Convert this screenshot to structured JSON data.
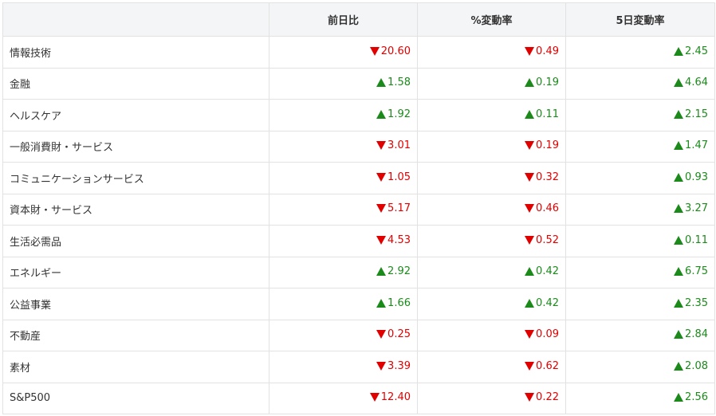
{
  "headers": [
    "",
    "前日比",
    "%変動率",
    "5日変動率"
  ],
  "colors": {
    "up": "#1b8a1b",
    "down": "#e00000"
  },
  "rows": [
    {
      "name": "情報技術",
      "cells": [
        {
          "dir": "down",
          "value": "20.60"
        },
        {
          "dir": "down",
          "value": "0.49"
        },
        {
          "dir": "up",
          "value": "2.45"
        }
      ]
    },
    {
      "name": "金融",
      "cells": [
        {
          "dir": "up",
          "value": "1.58"
        },
        {
          "dir": "up",
          "value": "0.19"
        },
        {
          "dir": "up",
          "value": "4.64"
        }
      ]
    },
    {
      "name": "ヘルスケア",
      "cells": [
        {
          "dir": "up",
          "value": "1.92"
        },
        {
          "dir": "up",
          "value": "0.11"
        },
        {
          "dir": "up",
          "value": "2.15"
        }
      ]
    },
    {
      "name": "一般消費財・サービス",
      "cells": [
        {
          "dir": "down",
          "value": "3.01"
        },
        {
          "dir": "down",
          "value": "0.19"
        },
        {
          "dir": "up",
          "value": "1.47"
        }
      ]
    },
    {
      "name": "コミュニケーションサービス",
      "cells": [
        {
          "dir": "down",
          "value": "1.05"
        },
        {
          "dir": "down",
          "value": "0.32"
        },
        {
          "dir": "up",
          "value": "0.93"
        }
      ]
    },
    {
      "name": "資本財・サービス",
      "cells": [
        {
          "dir": "down",
          "value": "5.17"
        },
        {
          "dir": "down",
          "value": "0.46"
        },
        {
          "dir": "up",
          "value": "3.27"
        }
      ]
    },
    {
      "name": "生活必需品",
      "cells": [
        {
          "dir": "down",
          "value": "4.53"
        },
        {
          "dir": "down",
          "value": "0.52"
        },
        {
          "dir": "up",
          "value": "0.11"
        }
      ]
    },
    {
      "name": "エネルギー",
      "cells": [
        {
          "dir": "up",
          "value": "2.92"
        },
        {
          "dir": "up",
          "value": "0.42"
        },
        {
          "dir": "up",
          "value": "6.75"
        }
      ]
    },
    {
      "name": "公益事業",
      "cells": [
        {
          "dir": "up",
          "value": "1.66"
        },
        {
          "dir": "up",
          "value": "0.42"
        },
        {
          "dir": "up",
          "value": "2.35"
        }
      ]
    },
    {
      "name": "不動産",
      "cells": [
        {
          "dir": "down",
          "value": "0.25"
        },
        {
          "dir": "down",
          "value": "0.09"
        },
        {
          "dir": "up",
          "value": "2.84"
        }
      ]
    },
    {
      "name": "素材",
      "cells": [
        {
          "dir": "down",
          "value": "3.39"
        },
        {
          "dir": "down",
          "value": "0.62"
        },
        {
          "dir": "up",
          "value": "2.08"
        }
      ]
    },
    {
      "name": "S&P500",
      "cells": [
        {
          "dir": "down",
          "value": "12.40"
        },
        {
          "dir": "down",
          "value": "0.22"
        },
        {
          "dir": "up",
          "value": "2.56"
        }
      ]
    }
  ]
}
